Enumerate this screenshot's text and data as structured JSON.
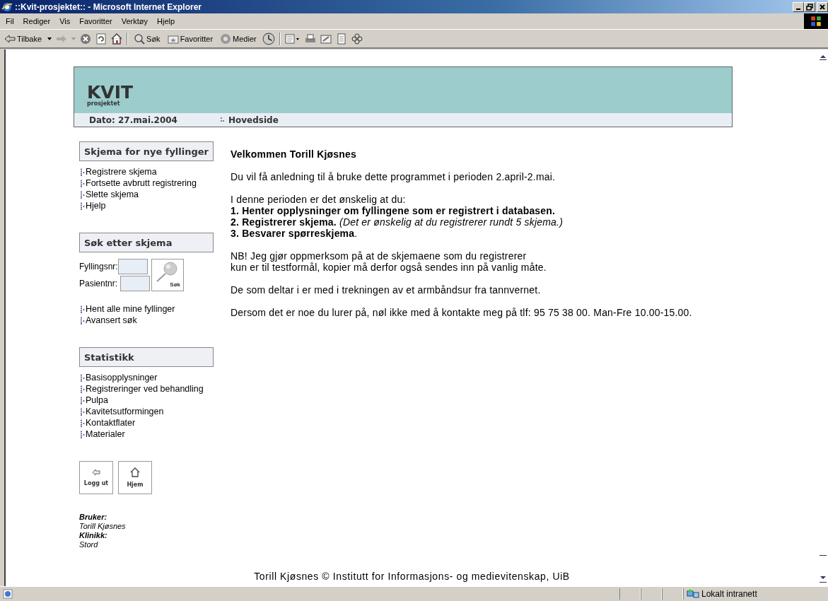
{
  "window": {
    "title": "::Kvit-prosjektet:: - Microsoft Internet Explorer"
  },
  "menu": [
    "Fil",
    "Rediger",
    "Vis",
    "Favoritter",
    "Verktøy",
    "Hjelp"
  ],
  "toolbar": {
    "back": "Tilbake",
    "search": "Søk",
    "favorites": "Favoritter",
    "media": "Medier"
  },
  "header": {
    "logo": "KVIT",
    "logo_sub": "prosjektet",
    "date": "Dato: 27.mai.2004",
    "breadcrumb": "Hovedside"
  },
  "sidebar": {
    "new_section": {
      "title": "Skjema for nye fyllinger",
      "links": [
        "Registrere skjema",
        "Fortsette avbrutt registrering",
        "Slette skjema",
        "Hjelp"
      ]
    },
    "search_section": {
      "title": "Søk etter skjema",
      "fields": [
        {
          "label": "Fyllingsnr:"
        },
        {
          "label": "Pasientnr:"
        }
      ],
      "button": "Søk",
      "links": [
        "Hent alle mine fyllinger",
        "Avansert søk"
      ]
    },
    "stats_section": {
      "title": "Statistikk",
      "links": [
        "Basisopplysninger",
        "Registreringer ved behandling",
        "Pulpa",
        "Kavitetsutformingen",
        "Kontaktflater",
        "Materialer"
      ]
    },
    "buttons": [
      {
        "label": "Logg ut"
      },
      {
        "label": "Hjem"
      }
    ],
    "user": [
      {
        "kind": "label",
        "text": "Bruker:"
      },
      {
        "kind": "value",
        "text": "Torill Kjøsnes"
      },
      {
        "kind": "label",
        "text": "Klinikk:"
      },
      {
        "kind": "value",
        "text": "Stord"
      }
    ]
  },
  "main": {
    "heading": "Velkommen Torill Kjøsnes",
    "paragraphs": [
      [
        "Du vil få anledning til å bruke dette programmet i perioden 2.april-2.mai."
      ],
      [
        "I denne perioden er det ønskelig at du:",
        "**1. Henter opplysninger om fyllingene som er registrert i databasen.**",
        "**2. Registrerer skjema.** *(Det er ønskelig at du registrerer rundt 5 skjema.)*",
        "**3. Besvarer spørreskjema**."
      ],
      [
        "NB! Jeg gjør oppmerksom på at de skjemaene som du registrerer",
        "kun er til testformål, kopier må derfor også sendes inn på vanlig måte."
      ],
      [
        "De som deltar i er med i trekningen av et armbåndsur fra tannvernet."
      ],
      [
        "Dersom det er noe du lurer på, nøl ikke med å kontakte meg på tlf: 95 75 38 00. Man-Fre 10.00-15.00."
      ]
    ]
  },
  "footer": "Torill Kjøsnes © Institutt for Informasjons- og medievitenskap, UiB",
  "status_bar": {
    "zone": "Lokalt intranett"
  }
}
